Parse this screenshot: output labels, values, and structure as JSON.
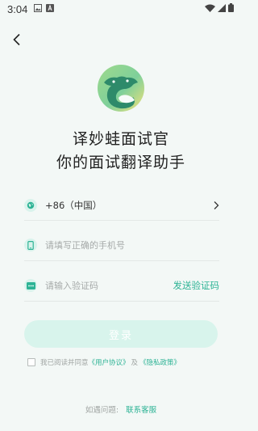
{
  "status_bar": {
    "time": "3:04"
  },
  "app": {
    "title_line1": "译妙蛙面试官",
    "title_line2": "你的面试翻译助手"
  },
  "colors": {
    "accent": "#2db395",
    "button_disabled": "#d8f4ec",
    "background": "#f3f8f6"
  },
  "form": {
    "country_code": "+86（中国）",
    "phone_placeholder": "请填写正确的手机号",
    "code_placeholder": "请输入验证码",
    "send_code": "发送验证码"
  },
  "login_button": "登录",
  "agreement": {
    "prefix": "我已阅读并同意",
    "user_agreement": "《用户协议》",
    "and": "及",
    "privacy_policy": "《隐私政策》"
  },
  "help": {
    "question": "如遇问题:",
    "contact": "联系客服"
  },
  "icons": {
    "back": "back-arrow-icon",
    "globe": "globe-icon",
    "phone": "phone-icon",
    "code": "message-code-icon",
    "chevron": "chevron-right-icon"
  }
}
